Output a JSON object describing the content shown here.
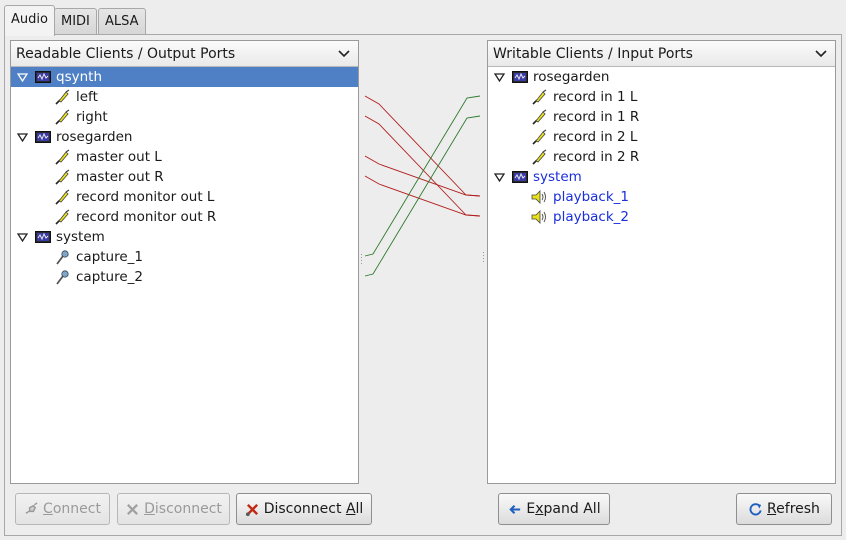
{
  "tabs": [
    {
      "label": "Audio",
      "active": true
    },
    {
      "label": "MIDI",
      "active": false
    },
    {
      "label": "ALSA",
      "active": false
    }
  ],
  "readable": {
    "header": "Readable Clients / Output Ports",
    "rows": [
      {
        "label": "qsynth",
        "type": "client",
        "selected": true
      },
      {
        "label": "left",
        "type": "port"
      },
      {
        "label": "right",
        "type": "port"
      },
      {
        "label": "rosegarden",
        "type": "client"
      },
      {
        "label": "master out L",
        "type": "port"
      },
      {
        "label": "master out R",
        "type": "port"
      },
      {
        "label": "record monitor out L",
        "type": "port"
      },
      {
        "label": "record monitor out R",
        "type": "port"
      },
      {
        "label": "system",
        "type": "client"
      },
      {
        "label": "capture_1",
        "type": "mic"
      },
      {
        "label": "capture_2",
        "type": "mic"
      }
    ]
  },
  "writable": {
    "header": "Writable Clients / Input Ports",
    "rows": [
      {
        "label": "rosegarden",
        "type": "client"
      },
      {
        "label": "record in 1 L",
        "type": "port"
      },
      {
        "label": "record in 1 R",
        "type": "port"
      },
      {
        "label": "record in 2 L",
        "type": "port"
      },
      {
        "label": "record in 2 R",
        "type": "port"
      },
      {
        "label": "system",
        "type": "client",
        "connected": true
      },
      {
        "label": "playback_1",
        "type": "speaker",
        "connected": true
      },
      {
        "label": "playback_2",
        "type": "speaker",
        "connected": true
      }
    ]
  },
  "buttons": {
    "connect": {
      "prefix": "",
      "accel": "C",
      "suffix": "onnect"
    },
    "disconnect": {
      "prefix": "",
      "accel": "D",
      "suffix": "isconnect"
    },
    "disconnect_all": {
      "prefix": "Disconnect ",
      "accel": "A",
      "suffix": "ll"
    },
    "expand_all": {
      "prefix": "E",
      "accel": "x",
      "suffix": "pand All"
    },
    "refresh": {
      "prefix": "",
      "accel": "R",
      "suffix": "efresh"
    }
  },
  "colors": {
    "selection": "#4f7fc4",
    "connected_text": "#1a2edc",
    "audio_conn": "#b21c1c",
    "capture_conn": "#2d7a2d"
  }
}
